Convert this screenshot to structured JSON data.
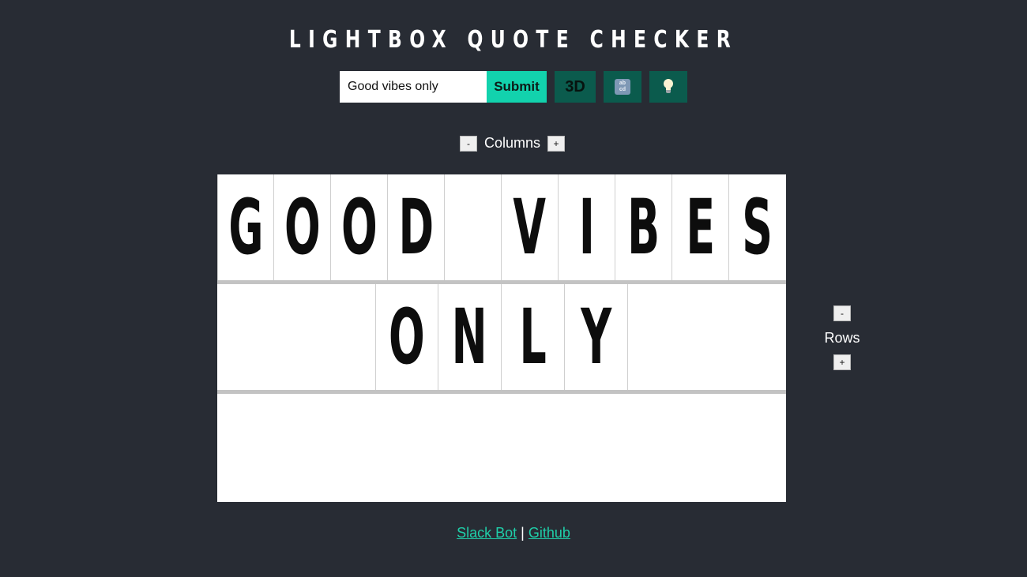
{
  "header": {
    "title": "LIGHTBOX QUOTE CHECKER"
  },
  "toolbar": {
    "input_value": "Good vibes only",
    "submit_label": "Submit",
    "three_d_label": "3D",
    "abcd_icon_top": "ab",
    "abcd_icon_bottom": "cd",
    "bulb_icon": "light-bulb-icon"
  },
  "columns": {
    "minus": "-",
    "label": "Columns",
    "plus": "+"
  },
  "rows": {
    "minus": "-",
    "label": "Rows",
    "plus": "+"
  },
  "board": {
    "row1": [
      "G",
      "O",
      "O",
      "D",
      "",
      "V",
      "I",
      "B",
      "E",
      "S"
    ],
    "row2": [
      "O",
      "N",
      "L",
      "Y"
    ],
    "row3": []
  },
  "footer": {
    "slack_label": "Slack Bot",
    "separator": "|",
    "github_label": "Github"
  },
  "colors": {
    "background": "#282c34",
    "accent": "#12d2ad",
    "tool_button": "#0b5b4d",
    "link": "#1fcfa9"
  }
}
